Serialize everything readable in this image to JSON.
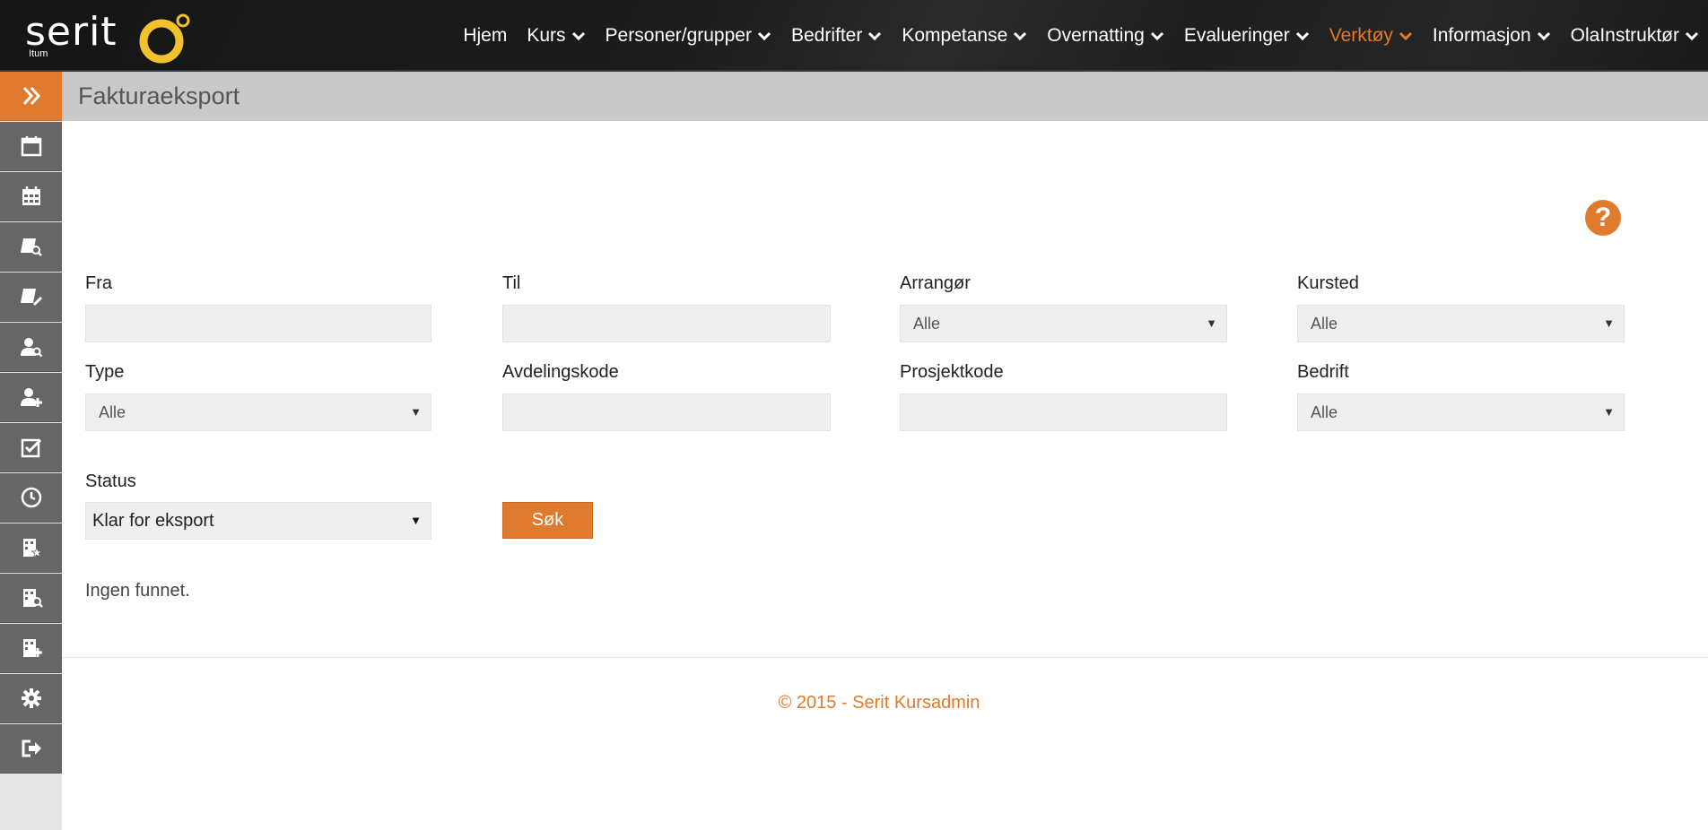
{
  "logo": {
    "name": "serit",
    "sub": "Itum"
  },
  "nav": {
    "items": [
      {
        "label": "Hjem",
        "dropdown": false,
        "active": false
      },
      {
        "label": "Kurs",
        "dropdown": true,
        "active": false
      },
      {
        "label": "Personer/grupper",
        "dropdown": true,
        "active": false
      },
      {
        "label": "Bedrifter",
        "dropdown": true,
        "active": false
      },
      {
        "label": "Kompetanse",
        "dropdown": true,
        "active": false
      },
      {
        "label": "Overnatting",
        "dropdown": true,
        "active": false
      },
      {
        "label": "Evalueringer",
        "dropdown": true,
        "active": false
      },
      {
        "label": "Verktøy",
        "dropdown": true,
        "active": true
      },
      {
        "label": "Informasjon",
        "dropdown": true,
        "active": false
      },
      {
        "label": "OlaInstruktør",
        "dropdown": true,
        "active": false
      }
    ]
  },
  "sidebar": {
    "icons": [
      "expand-icon",
      "calendar-icon",
      "calendar-grid-icon",
      "course-search-icon",
      "course-edit-icon",
      "person-search-icon",
      "person-add-icon",
      "checkbox-icon",
      "clock-icon",
      "company-star-icon",
      "company-search-icon",
      "company-add-icon",
      "gear-icon",
      "logout-icon"
    ]
  },
  "page": {
    "title": "Fakturaeksport"
  },
  "form": {
    "fra_label": "Fra",
    "til_label": "Til",
    "arrangor_label": "Arrangør",
    "arrangor_value": "Alle",
    "kursted_label": "Kursted",
    "kursted_value": "Alle",
    "type_label": "Type",
    "type_value": "Alle",
    "avdelingskode_label": "Avdelingskode",
    "prosjektkode_label": "Prosjektkode",
    "bedrift_label": "Bedrift",
    "bedrift_value": "Alle",
    "status_label": "Status",
    "status_value": "Klar for eksport",
    "search_label": "Søk"
  },
  "result": {
    "empty_message": "Ingen funnet."
  },
  "footer": {
    "text": "© 2015 - Serit Kursadmin"
  },
  "colors": {
    "accent": "#e07a2e",
    "sidebar": "#666666",
    "header_strip": "#c9c9c9"
  }
}
